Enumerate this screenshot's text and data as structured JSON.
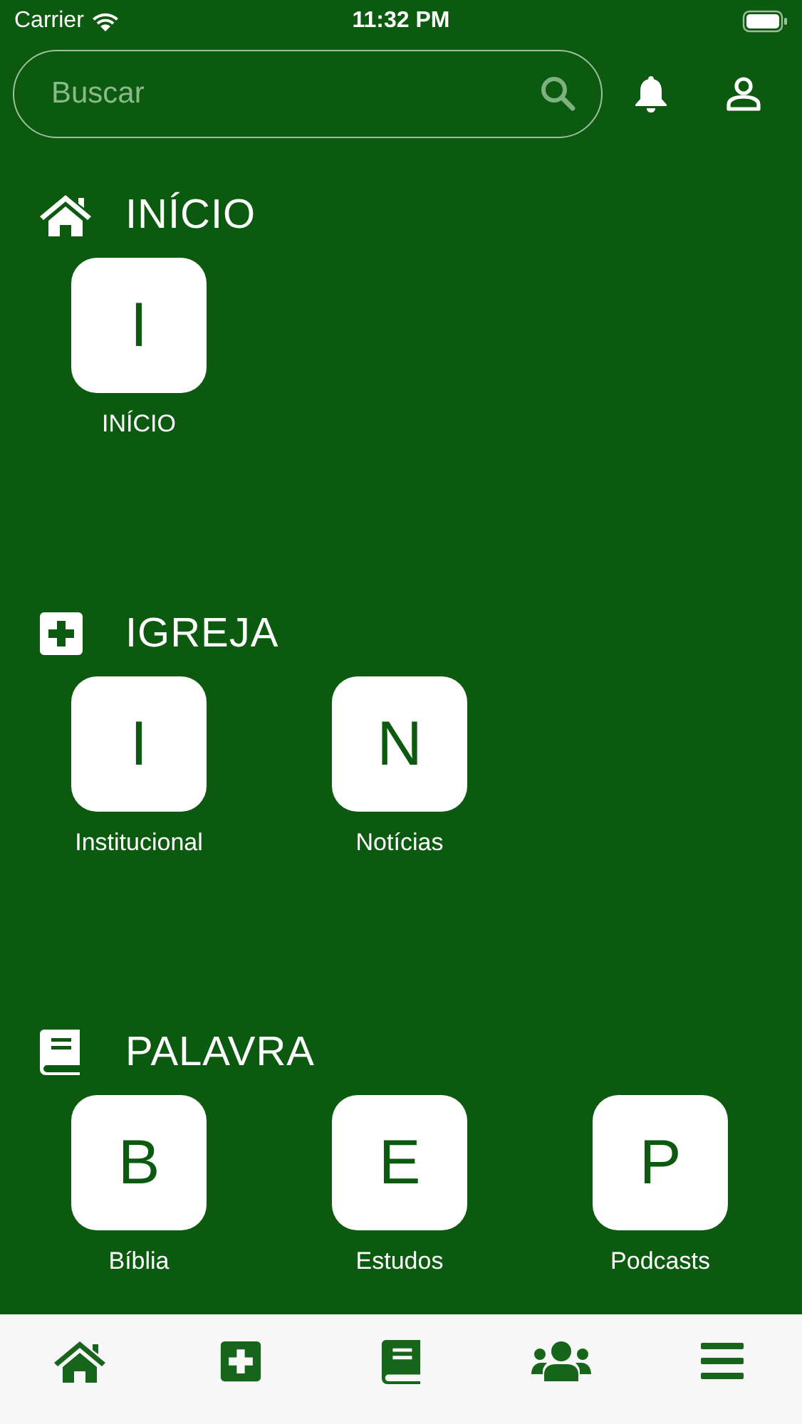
{
  "status_bar": {
    "carrier": "Carrier",
    "time": "11:32 PM"
  },
  "search": {
    "placeholder": "Buscar"
  },
  "sections": [
    {
      "title": "INÍCIO",
      "items": [
        {
          "letter": "I",
          "label": "INÍCIO"
        }
      ]
    },
    {
      "title": "IGREJA",
      "items": [
        {
          "letter": "I",
          "label": "Institucional"
        },
        {
          "letter": "N",
          "label": "Notícias"
        }
      ]
    },
    {
      "title": "PALAVRA",
      "items": [
        {
          "letter": "B",
          "label": "Bíblia"
        },
        {
          "letter": "E",
          "label": "Estudos"
        },
        {
          "letter": "P",
          "label": "Podcasts"
        }
      ]
    }
  ]
}
